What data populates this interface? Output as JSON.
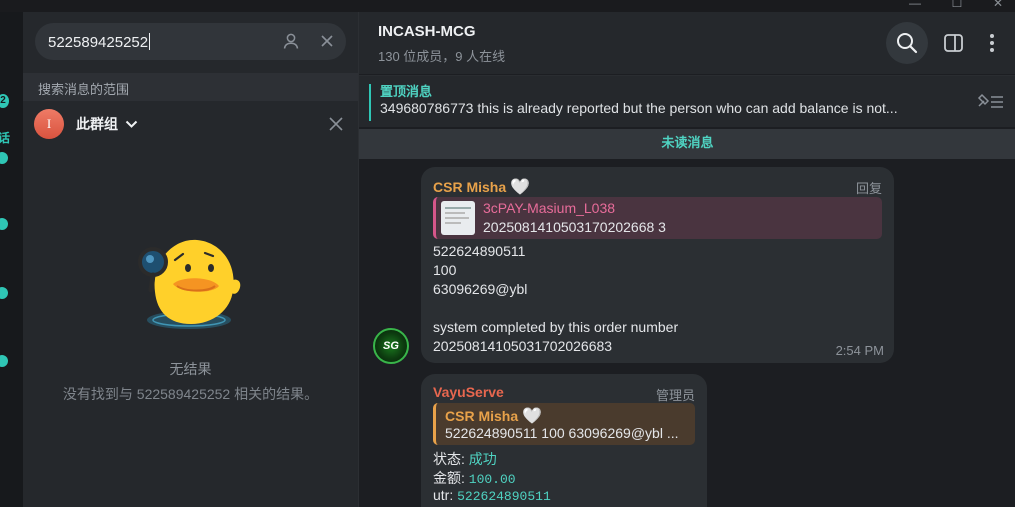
{
  "window": {
    "minimize": "—",
    "maximize": "☐",
    "close": "✕"
  },
  "strip": {
    "badge_count": "2",
    "active_text": "话"
  },
  "search": {
    "query": "522589425252",
    "scope_label": "搜索消息的范围",
    "chat_label": "此群组",
    "avatar_letter": "I",
    "no_result_title": "无结果",
    "no_result_desc": "没有找到与 522589425252 相关的结果。"
  },
  "header": {
    "title": "INCASH-MCG",
    "subtitle": "130 位成员，9 人在线"
  },
  "pinned": {
    "title": "置顶消息",
    "text": "349680786773   this is already reported but the person who can add balance is not..."
  },
  "unread_label": "未读消息",
  "messages": [
    {
      "sender": "CSR Misha",
      "sender_heart": "🤍",
      "role": "回复",
      "quote_title": "3cPAY-Masium_L038",
      "quote_text": "2025081410503170202668 3",
      "lines": [
        "522624890511",
        "100",
        "63096269@ybl",
        "",
        "system completed by this order number",
        "20250814105031702026683"
      ],
      "time": "2:54 PM",
      "avatar_text": "SG"
    },
    {
      "sender": "VayuServe",
      "role": "管理员",
      "quote_title": "CSR Misha",
      "quote_heart": "🤍",
      "quote_text": "522624890511 100 63096269@ybl ...",
      "status_label": "状态:",
      "status_value": "成功",
      "amount_label": "金额:",
      "amount_value": "100.00",
      "utr_label": "utr:",
      "utr_value": "522624890511"
    }
  ],
  "colors": {
    "accent": "#2fc6b5",
    "sender1": "#e8a24a",
    "sender2": "#e8674f",
    "quote1_bar": "#d6568a",
    "quote2_bar": "#e8a24a"
  }
}
